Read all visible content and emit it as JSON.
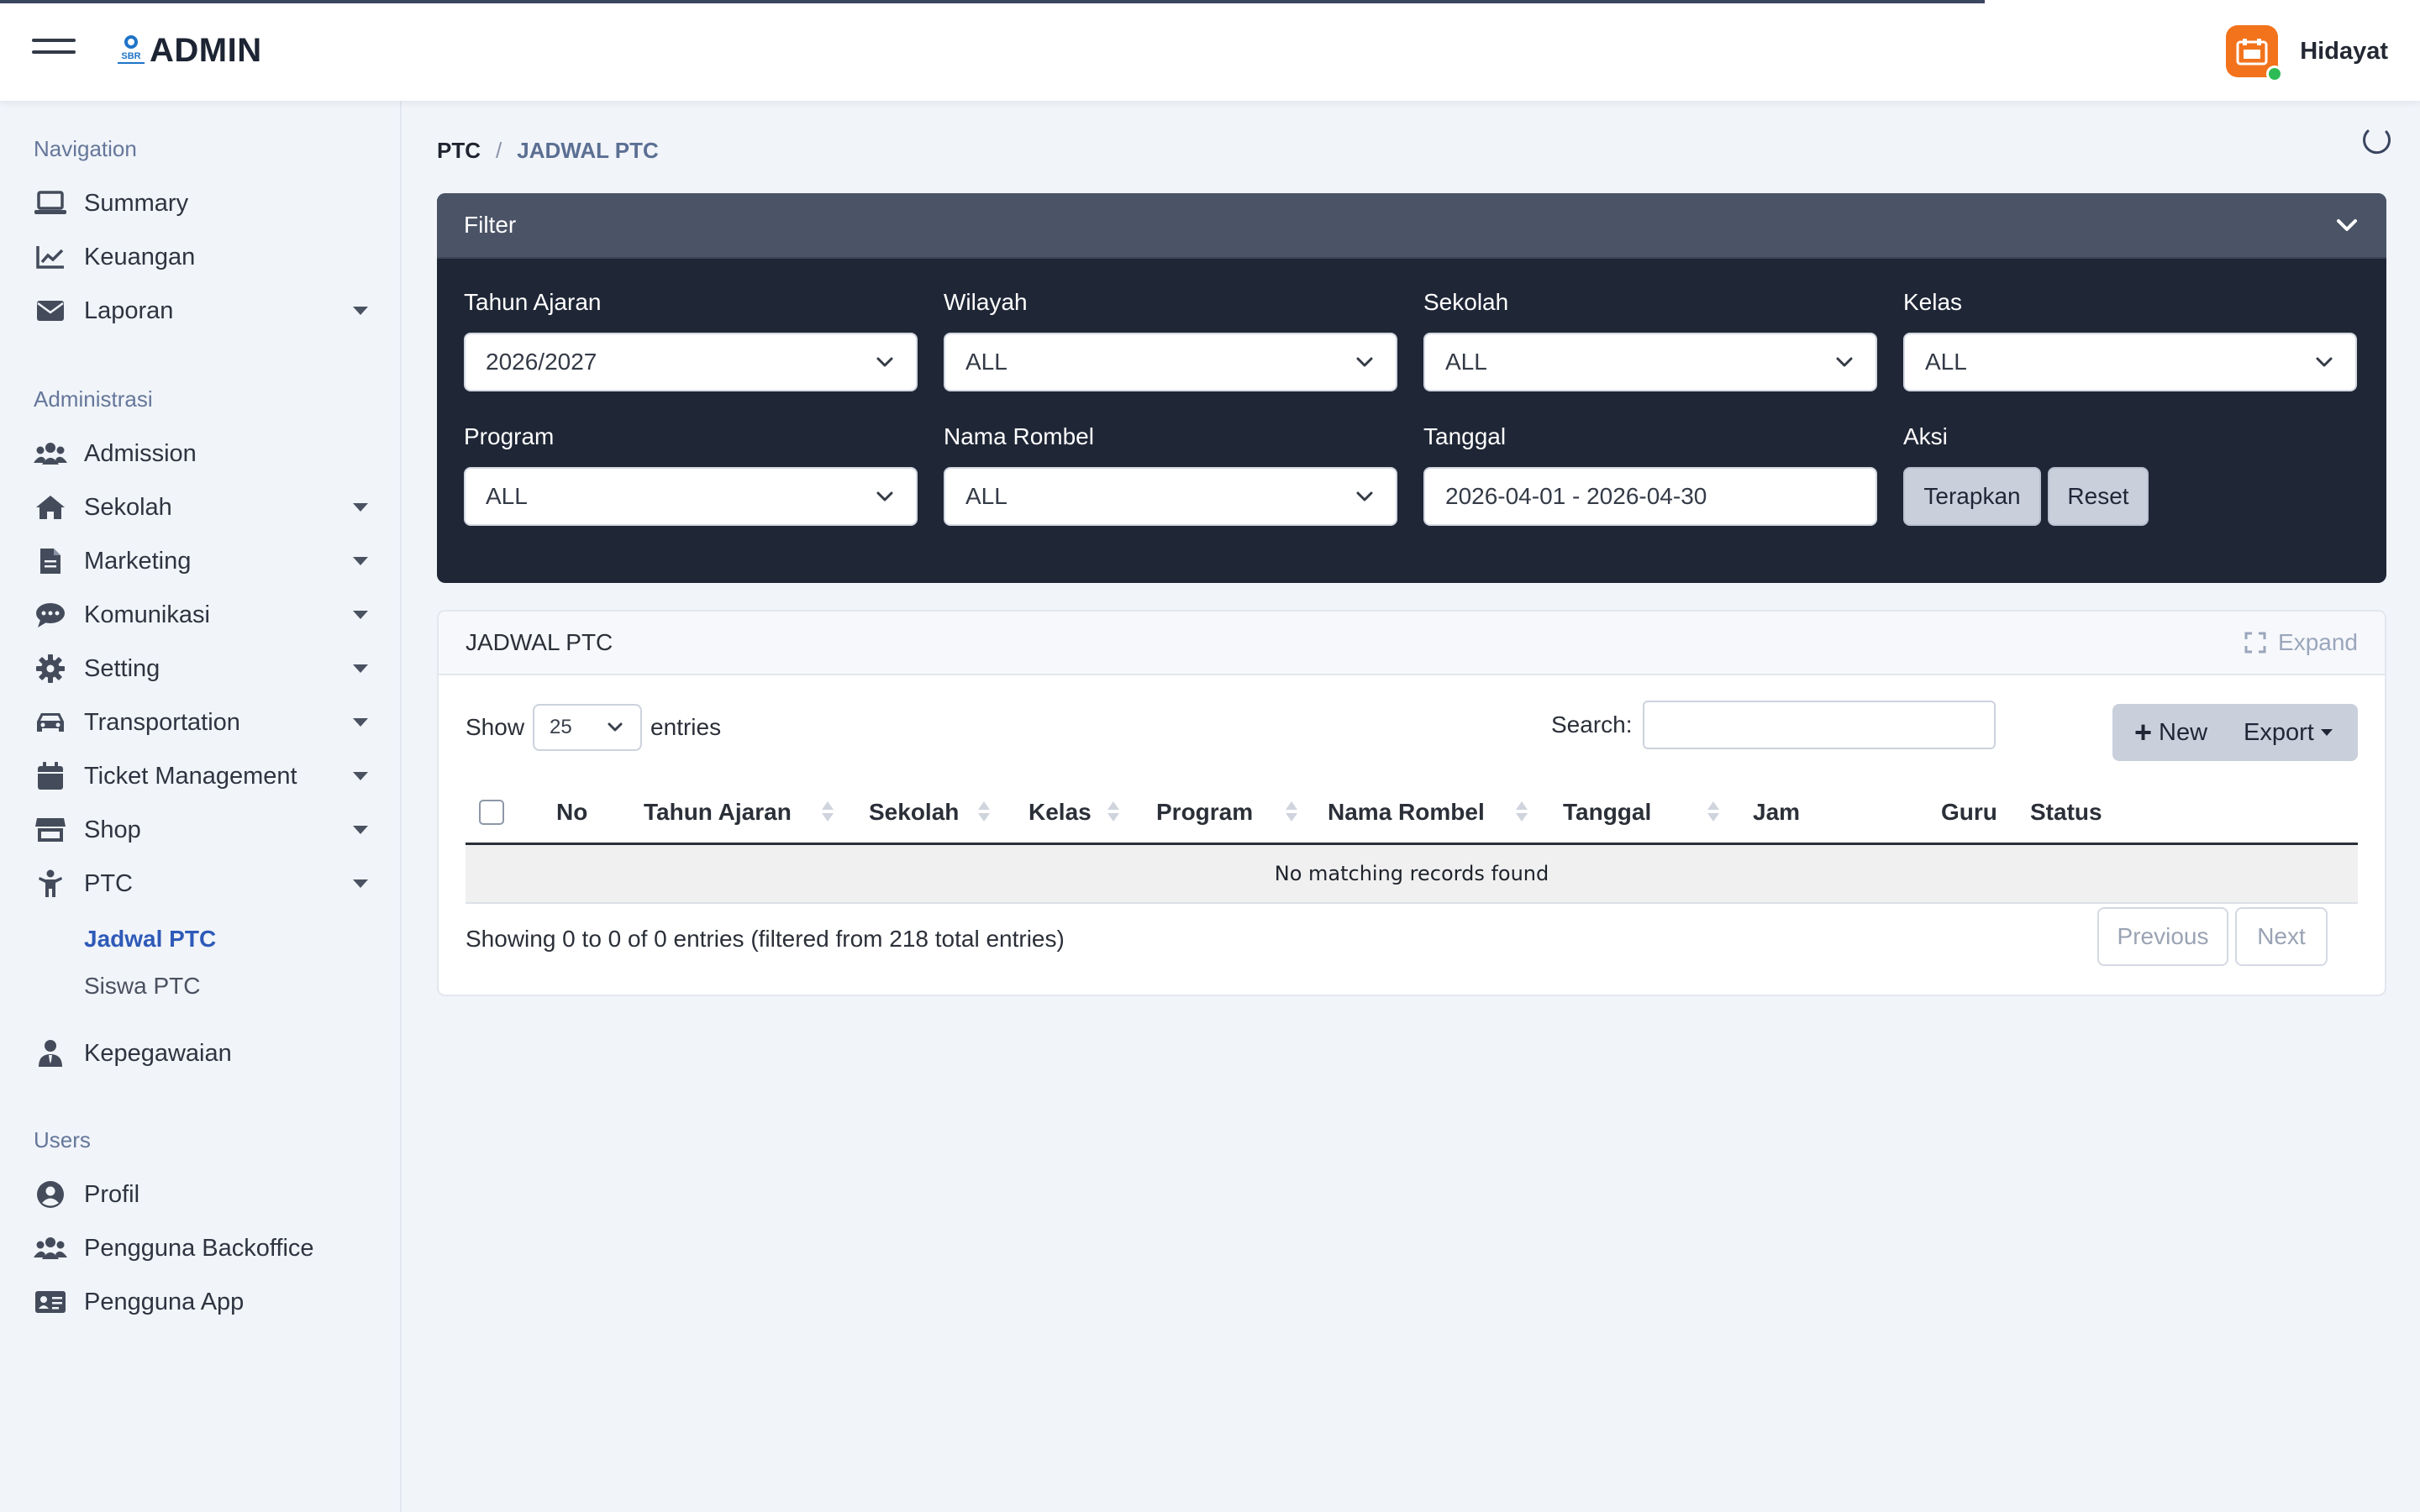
{
  "header": {
    "brand": "ADMIN",
    "logo_text": "SBR",
    "user_name": "Hidayat"
  },
  "sidebar": {
    "sections": {
      "navigation": "Navigation",
      "administrasi": "Administrasi",
      "users": "Users"
    },
    "items": {
      "summary": "Summary",
      "keuangan": "Keuangan",
      "laporan": "Laporan",
      "admission": "Admission",
      "sekolah": "Sekolah",
      "marketing": "Marketing",
      "komunikasi": "Komunikasi",
      "setting": "Setting",
      "transportation": "Transportation",
      "ticket": "Ticket Management",
      "shop": "Shop",
      "ptc": "PTC",
      "jadwal_ptc": "Jadwal PTC",
      "siswa_ptc": "Siswa PTC",
      "kepegawaian": "Kepegawaian",
      "profil": "Profil",
      "pengguna_backoffice": "Pengguna Backoffice",
      "pengguna_app": "Pengguna App"
    }
  },
  "breadcrumb": {
    "root": "PTC",
    "separator": "/",
    "current": "JADWAL PTC"
  },
  "filter": {
    "title": "Filter",
    "fields": {
      "tahun_ajaran": {
        "label": "Tahun Ajaran",
        "value": "2026/2027"
      },
      "wilayah": {
        "label": "Wilayah",
        "value": "ALL"
      },
      "sekolah": {
        "label": "Sekolah",
        "value": "ALL"
      },
      "kelas": {
        "label": "Kelas",
        "value": "ALL"
      },
      "program": {
        "label": "Program",
        "value": "ALL"
      },
      "nama_rombel": {
        "label": "Nama Rombel",
        "value": "ALL"
      },
      "tanggal": {
        "label": "Tanggal",
        "value": "2026-04-01 - 2026-04-30"
      }
    },
    "aksi_label": "Aksi",
    "apply_label": "Terapkan",
    "reset_label": "Reset"
  },
  "table_card": {
    "title": "JADWAL PTC",
    "expand_label": "Expand",
    "show_label": "Show",
    "page_length": "25",
    "entries_label": "entries",
    "search_label": "Search:",
    "search_value": "",
    "new_label": "New",
    "export_label": "Export",
    "columns": {
      "no": "No",
      "tahun_ajaran": "Tahun Ajaran",
      "sekolah": "Sekolah",
      "kelas": "Kelas",
      "program": "Program",
      "nama_rombel": "Nama Rombel",
      "tanggal": "Tanggal",
      "jam": "Jam",
      "guru": "Guru",
      "status": "Status"
    },
    "empty_message": "No matching records found",
    "info": "Showing 0 to 0 of 0 entries (filtered from 218 total entries)",
    "prev_label": "Previous",
    "next_label": "Next"
  },
  "colors": {
    "filter_header": "#4b5366",
    "filter_body": "#1f2636",
    "active_nav": "#2e5ab8",
    "avatar": "#f2731c",
    "online": "#2dbb55"
  }
}
